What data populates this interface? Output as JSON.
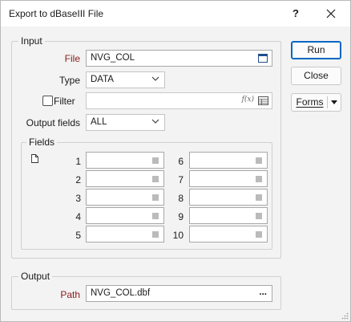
{
  "window": {
    "title": "Export to dBaseIII File",
    "help_label": "?",
    "close_icon": "close-icon"
  },
  "input_group": {
    "title": "Input",
    "file_label": "File",
    "file_value": "NVG_COL",
    "type_label": "Type",
    "type_value": "DATA",
    "filter_label": "Filter",
    "filter_checked": false,
    "filter_value": "",
    "filter_fx": "f(x)",
    "output_fields_label": "Output fields",
    "output_fields_value": "ALL"
  },
  "fields_group": {
    "title": "Fields",
    "left": [
      {
        "num": "1",
        "value": ""
      },
      {
        "num": "2",
        "value": ""
      },
      {
        "num": "3",
        "value": ""
      },
      {
        "num": "4",
        "value": ""
      },
      {
        "num": "5",
        "value": ""
      }
    ],
    "right": [
      {
        "num": "6",
        "value": ""
      },
      {
        "num": "7",
        "value": ""
      },
      {
        "num": "8",
        "value": ""
      },
      {
        "num": "9",
        "value": ""
      },
      {
        "num": "10",
        "value": ""
      }
    ]
  },
  "output_group": {
    "title": "Output",
    "path_label": "Path",
    "path_value": "NVG_COL.dbf",
    "browse_label": "..."
  },
  "buttons": {
    "run": "Run",
    "close": "Close",
    "forms": "Forms"
  },
  "colors": {
    "accent": "#0067c0",
    "required_label": "#8b1a1a"
  }
}
